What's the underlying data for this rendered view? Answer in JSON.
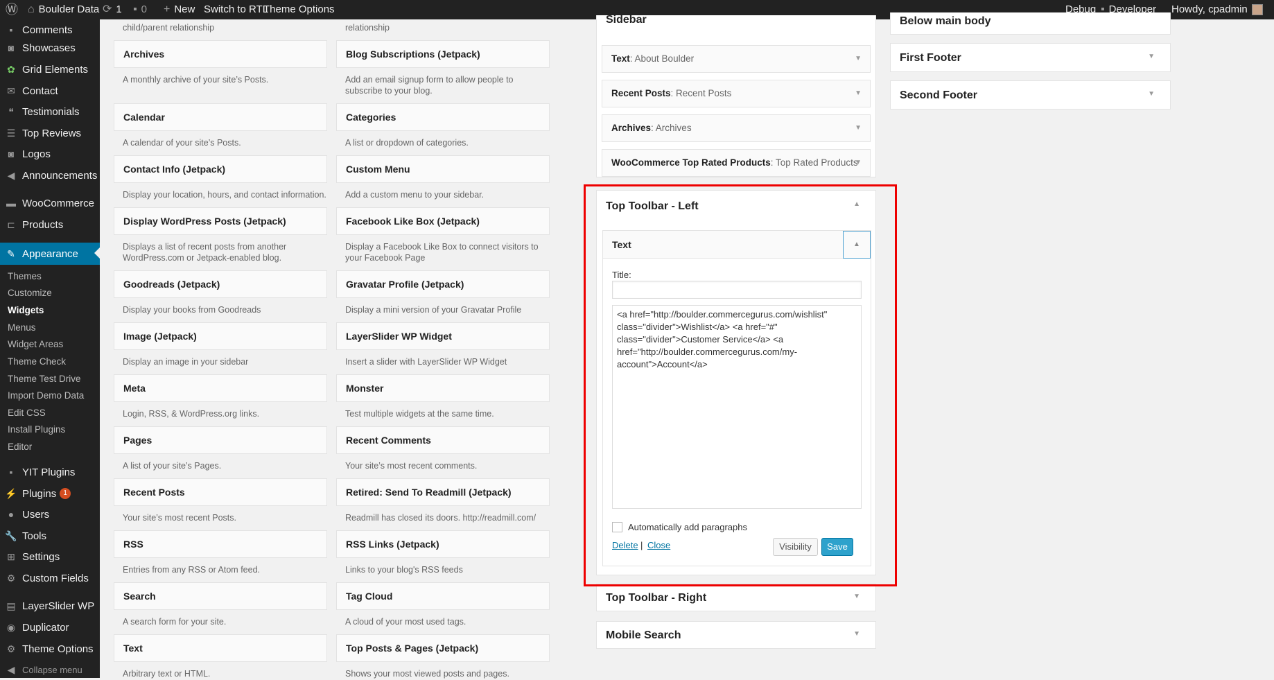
{
  "adminbar": {
    "site": "Boulder Data",
    "updates": "1",
    "comments": "0",
    "new": "New",
    "rtl": "Switch to RTL",
    "theme_options": "Theme Options",
    "debug": "Debug",
    "developer": "Developer",
    "howdy": "Howdy, cpadmin"
  },
  "menu": {
    "comments": "Comments",
    "showcases": "Showcases",
    "grid": "Grid Elements",
    "contact": "Contact",
    "testimonials": "Testimonials",
    "top_reviews": "Top Reviews",
    "logos": "Logos",
    "announcements": "Announcements",
    "woocommerce": "WooCommerce",
    "products": "Products",
    "appearance": "Appearance",
    "themes": "Themes",
    "customize": "Customize",
    "widgets": "Widgets",
    "menus": "Menus",
    "widget_areas": "Widget Areas",
    "theme_check": "Theme Check",
    "theme_test": "Theme Test Drive",
    "import_demo": "Import Demo Data",
    "edit_css": "Edit CSS",
    "install_plugins": "Install Plugins",
    "editor": "Editor",
    "yit": "YIT Plugins",
    "plugins": "Plugins",
    "plugins_count": "1",
    "users": "Users",
    "tools": "Tools",
    "settings": "Settings",
    "custom_fields": "Custom Fields",
    "layerslider": "LayerSlider WP",
    "duplicator": "Duplicator",
    "theme_options": "Theme Options",
    "collapse": "Collapse menu"
  },
  "widgets": {
    "top_desc_left": "child/parent relationship",
    "top_desc_right": "relationship",
    "w1t": "Archives",
    "w1d": "A monthly archive of your site’s Posts.",
    "w2t": "Blog Subscriptions (Jetpack)",
    "w2d": "Add an email signup form to allow people to subscribe to your blog.",
    "w3t": "Calendar",
    "w3d": "A calendar of your site’s Posts.",
    "w4t": "Categories",
    "w4d": "A list or dropdown of categories.",
    "w5t": "Contact Info (Jetpack)",
    "w5d": "Display your location, hours, and contact information.",
    "w6t": "Custom Menu",
    "w6d": "Add a custom menu to your sidebar.",
    "w7t": "Display WordPress Posts (Jetpack)",
    "w7d": "Displays a list of recent posts from another WordPress.com or Jetpack-enabled blog.",
    "w8t": "Facebook Like Box (Jetpack)",
    "w8d": "Display a Facebook Like Box to connect visitors to your Facebook Page",
    "w9t": "Goodreads (Jetpack)",
    "w9d": "Display your books from Goodreads",
    "w10t": "Gravatar Profile (Jetpack)",
    "w10d": "Display a mini version of your Gravatar Profile",
    "w11t": "Image (Jetpack)",
    "w11d": "Display an image in your sidebar",
    "w12t": "LayerSlider WP Widget",
    "w12d": "Insert a slider with LayerSlider WP Widget",
    "w13t": "Meta",
    "w13d": "Login, RSS, & WordPress.org links.",
    "w14t": "Monster",
    "w14d": "Test multiple widgets at the same time.",
    "w15t": "Pages",
    "w15d": "A list of your site’s Pages.",
    "w16t": "Recent Comments",
    "w16d": "Your site’s most recent comments.",
    "w17t": "Recent Posts",
    "w17d": "Your site’s most recent Posts.",
    "w18t": "Retired: Send To Readmill (Jetpack)",
    "w18d": "Readmill has closed its doors. http://readmill.com/",
    "w19t": "RSS",
    "w19d": "Entries from any RSS or Atom feed.",
    "w20t": "RSS Links (Jetpack)",
    "w20d": "Links to your blog's RSS feeds",
    "w21t": "Search",
    "w21d": "A search form for your site.",
    "w22t": "Tag Cloud",
    "w22d": "A cloud of your most used tags.",
    "w23t": "Text",
    "w23d": "Arbitrary text or HTML.",
    "w24t": "Top Posts & Pages (Jetpack)",
    "w24d": "Shows your most viewed posts and pages."
  },
  "sidebar_area": {
    "title": "Sidebar",
    "s1a": "Text",
    "s1b": ": About Boulder",
    "s2a": "Recent Posts",
    "s2b": ": Recent Posts",
    "s3a": "Archives",
    "s3b": ": Archives",
    "s4a": "WooCommerce Top Rated Products",
    "s4b": ": Top Rated Products"
  },
  "toolbar_left": {
    "title": "Top Toolbar - Left",
    "widget": "Text",
    "title_label": "Title:",
    "title_value": "",
    "content": "<a href=\"http://boulder.commercegurus.com/wishlist\" class=\"divider\">Wishlist</a> <a href=\"#\" class=\"divider\">Customer Service</a> <a href=\"http://boulder.commercegurus.com/my-account\">Account</a>",
    "autop": "Automatically add paragraphs",
    "delete": "Delete",
    "sep": "|",
    "close": "Close",
    "visibility": "Visibility",
    "save": "Save"
  },
  "areas": {
    "toolbar_right": "Top Toolbar - Right",
    "mobile_search": "Mobile Search",
    "below_main": "Below main body",
    "first_footer": "First Footer",
    "second_footer": "Second Footer"
  }
}
